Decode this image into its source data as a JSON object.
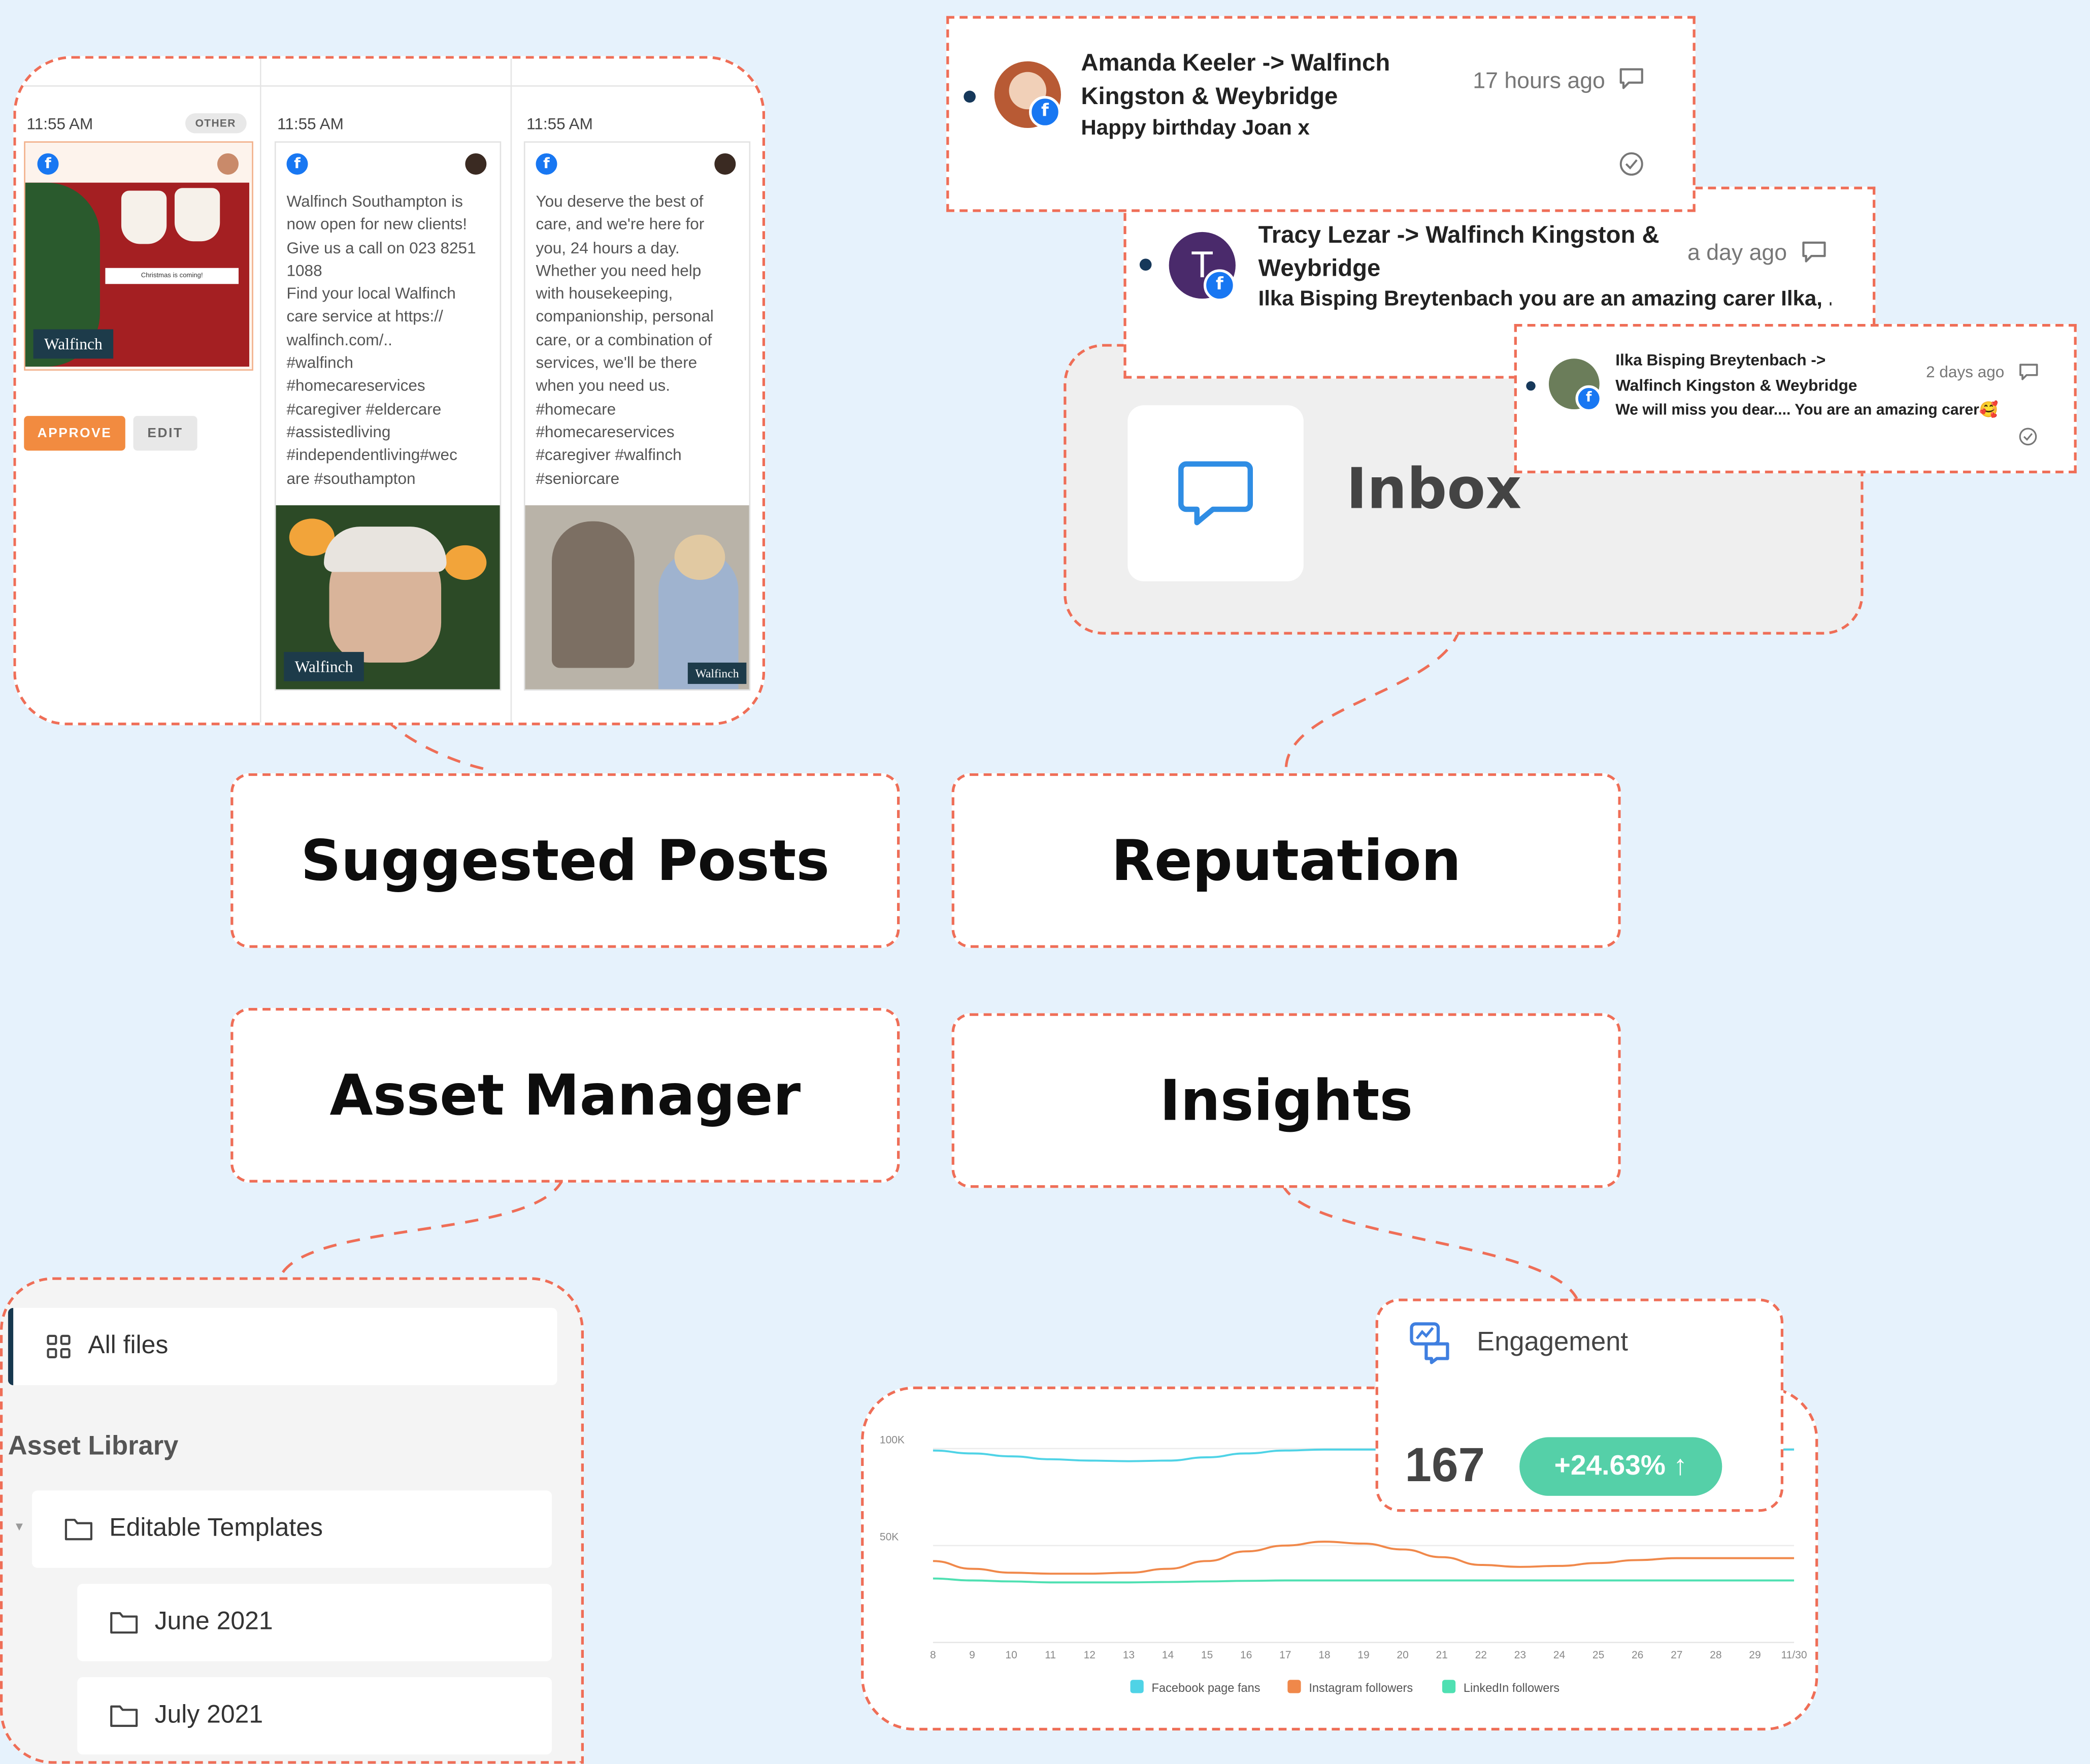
{
  "labels": {
    "suggested_posts": "Suggested Posts",
    "reputation": "Reputation",
    "asset_manager": "Asset Manager",
    "insights": "Insights"
  },
  "suggested_posts": {
    "columns": [
      {
        "time": "11:55 AM",
        "badge": "OTHER",
        "image_caption": "Christmas is coming!",
        "brand": "Walfinch",
        "approve_label": "APPROVE",
        "edit_label": "EDIT"
      },
      {
        "time": "11:55 AM",
        "text": "Walfinch Southampton is\nnow open for new clients!\nGive us a call on 023 8251\n1088\nFind your local Walfinch\ncare service at https://\nwalfinch.com/..\n#walfinch\n#homecareservices\n#caregiver #eldercare\n#assistedliving\n#independentliving#wec\nare #southampton",
        "brand": "Walfinch"
      },
      {
        "time": "11:55 AM",
        "text": "You deserve the best of\ncare, and we're here for\nyou, 24 hours a day.\nWhether you need help\nwith housekeeping,\ncompanionship, personal\ncare, or a combination of\nservices, we'll be there\nwhen you need us.\n#homecare\n#homecareservices\n#caregiver #walfinch\n#seniorcare",
        "brand": "Walfinch"
      }
    ]
  },
  "inbox": {
    "title": "Inbox",
    "notifications": [
      {
        "name": "Amanda Keeler -> Walfinch\nKingston & Weybridge",
        "message": "Happy birthday Joan x",
        "time": "17 hours ago"
      },
      {
        "name": "Tracy Lezar -> Walfinch Kingston &\nWeybridge",
        "initial": "T",
        "message": "Ilka Bisping Breytenbach you are an amazing carer Ilka, ...",
        "time": "a day ago"
      },
      {
        "name": "Ilka Bisping Breytenbach ->\nWalfinch Kingston & Weybridge",
        "message": "We will miss you dear.... You are an amazing carer🥰",
        "time": "2 days ago"
      }
    ]
  },
  "asset_manager": {
    "all_files": "All files",
    "library_heading": "Asset Library",
    "folders": [
      {
        "label": "Editable Templates"
      },
      {
        "label": "June 2021"
      },
      {
        "label": "July 2021"
      }
    ]
  },
  "insights": {
    "engagement_title": "Engagement",
    "engagement_value": "167",
    "engagement_change": "+24.63% ↑"
  },
  "chart_data": {
    "type": "line",
    "x": [
      "8",
      "9",
      "10",
      "11",
      "12",
      "13",
      "14",
      "15",
      "16",
      "17",
      "18",
      "19",
      "20",
      "21",
      "22",
      "23",
      "24",
      "25",
      "26",
      "27",
      "28",
      "29",
      "11/30"
    ],
    "y_ticks": [
      "100K",
      "50K"
    ],
    "ylim": [
      0,
      110000
    ],
    "series": [
      {
        "name": "Facebook page fans",
        "color": "#4fd3e6",
        "values": [
          99000,
          97500,
          96000,
          94500,
          93800,
          93500,
          93800,
          95500,
          97500,
          99000,
          99500,
          99500,
          99500,
          99500,
          99500,
          99500,
          99500,
          99500,
          99500,
          99500,
          99500,
          99500,
          99500
        ]
      },
      {
        "name": "Instagram followers",
        "color": "#f0884a",
        "values": [
          42000,
          38000,
          36000,
          35500,
          35500,
          36000,
          38000,
          42000,
          47000,
          50000,
          52000,
          51000,
          48000,
          44000,
          40000,
          39000,
          39500,
          41000,
          42500,
          43500,
          43500,
          43500,
          43500
        ]
      },
      {
        "name": "LinkedIn followers",
        "color": "#4fe0b2",
        "values": [
          33000,
          32000,
          31500,
          31000,
          31000,
          31000,
          31200,
          31500,
          31800,
          32000,
          32000,
          32000,
          32000,
          32000,
          32000,
          32000,
          32000,
          32000,
          32000,
          32000,
          32000,
          32000,
          32000
        ]
      }
    ],
    "legend_position": "bottom"
  }
}
